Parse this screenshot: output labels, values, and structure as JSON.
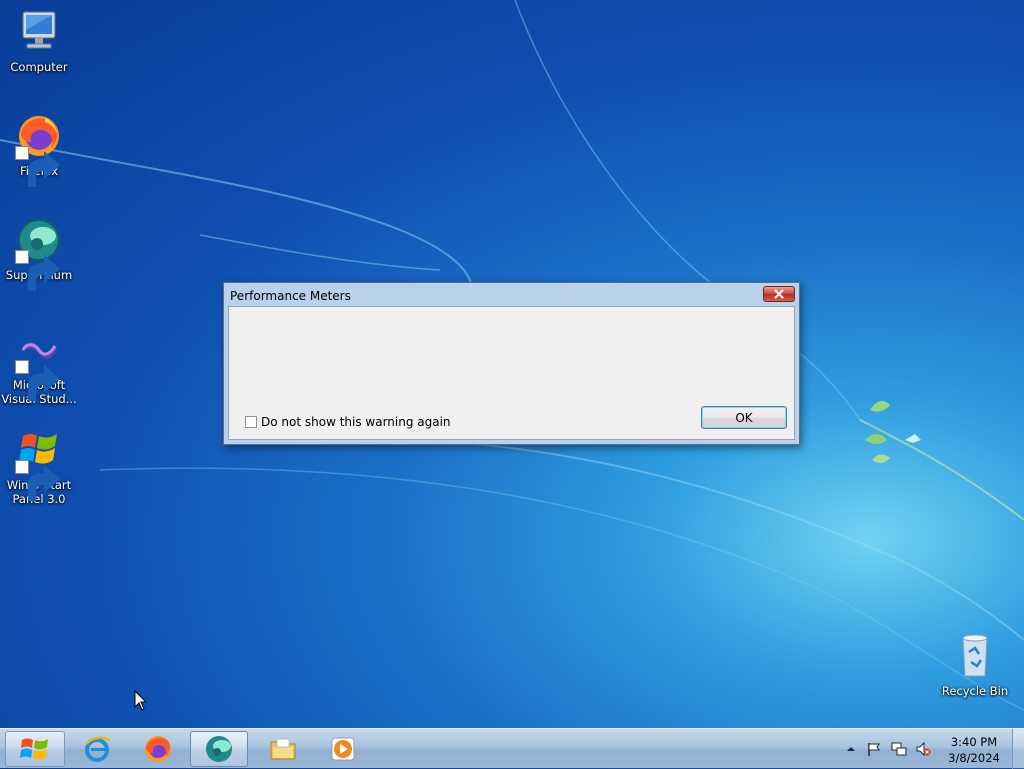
{
  "desktop": {
    "icons": [
      {
        "label": "Computer",
        "icon": "computer-icon"
      },
      {
        "label": "Firefox",
        "icon": "firefox-icon"
      },
      {
        "label": "Supermium",
        "icon": "supermium-icon"
      },
      {
        "label": "Microsoft Visual Stud...",
        "icon": "visual-studio-icon"
      },
      {
        "label": "Win 8 Start Panel 3.0",
        "icon": "windows-logo-icon"
      },
      {
        "label": "Recycle Bin",
        "icon": "recycle-bin-icon"
      }
    ]
  },
  "dialog": {
    "title": "Performance Meters",
    "checkbox_label": "Do not show this warning again",
    "checkbox_checked": false,
    "ok_label": "OK",
    "close_icon": "close-icon"
  },
  "taskbar": {
    "start_icon": "windows-start-icon",
    "pinned": [
      {
        "name": "internet-explorer",
        "icon": "internet-explorer-icon"
      },
      {
        "name": "firefox",
        "icon": "firefox-icon"
      },
      {
        "name": "supermium",
        "icon": "supermium-icon",
        "active": true
      },
      {
        "name": "file-explorer",
        "icon": "folder-icon"
      },
      {
        "name": "media-player",
        "icon": "media-player-icon"
      }
    ],
    "tray_icons": [
      "show-hidden-icons-arrow",
      "action-center-flag-icon",
      "network-icon",
      "volume-muted-icon"
    ],
    "clock": {
      "time": "3:40 PM",
      "date": "3/8/2024"
    }
  },
  "colors": {
    "desktop_blue": "#0f4fb0",
    "dialog_frame": "#b9d1ea",
    "close_red": "#c8483a"
  }
}
